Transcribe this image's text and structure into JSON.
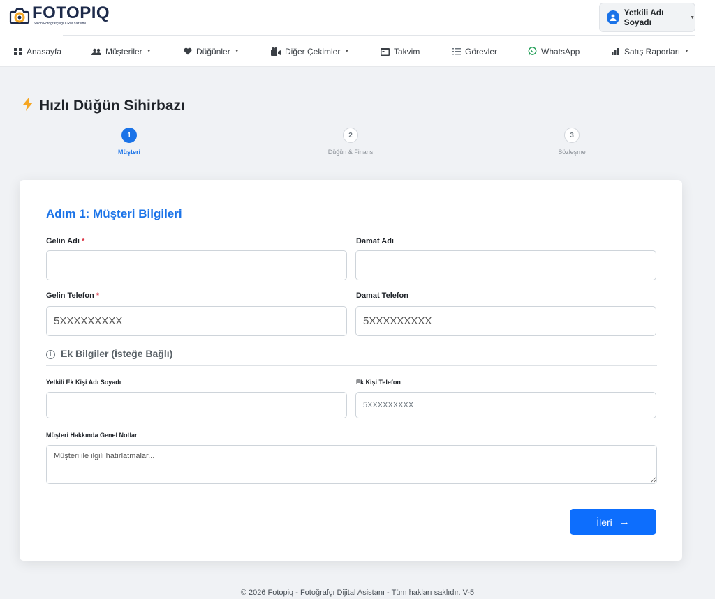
{
  "brand": {
    "name": "FOTOPIQ",
    "tagline": "Salon Fotoğrafçılığı CRM Yazılımı",
    "accent": "#1a73e8"
  },
  "user": {
    "name": "Yetkili Adı Soyadı"
  },
  "nav": {
    "items": [
      {
        "label": "Anasayfa",
        "icon": "grid-icon"
      },
      {
        "label": "Müşteriler",
        "icon": "users-icon"
      },
      {
        "label": "Düğünler",
        "icon": "heart-icon"
      },
      {
        "label": "Diğer Çekimler",
        "icon": "camera-icon"
      },
      {
        "label": "Takvim",
        "icon": "calendar-icon"
      },
      {
        "label": "Görevler",
        "icon": "list-icon"
      },
      {
        "label": "WhatsApp",
        "icon": "whatsapp-icon"
      },
      {
        "label": "Satış Raporları",
        "icon": "bar-chart-icon"
      }
    ]
  },
  "wizard": {
    "title": "Hızlı Düğün Sihirbazı",
    "steps": [
      {
        "number": "1",
        "label": "Müşteri",
        "state": "active"
      },
      {
        "number": "2",
        "label": "Düğün & Finans",
        "state": "idle"
      },
      {
        "number": "3",
        "label": "Sözleşme",
        "state": "idle"
      }
    ]
  },
  "form": {
    "title": "Adım 1: Müşteri Bilgileri",
    "required_mark": "*",
    "gelin_adi": {
      "label": "Gelin Adı",
      "value": "",
      "placeholder": ""
    },
    "damat_adi": {
      "label": "Damat Adı",
      "value": "",
      "placeholder": ""
    },
    "gelin_telefon": {
      "label": "Gelin Telefon",
      "value": "",
      "placeholder": "5XXXXXXXXX"
    },
    "damat_telefon": {
      "label": "Damat Telefon",
      "value": "",
      "placeholder": "5XXXXXXXXX"
    },
    "ek_bilgiler": {
      "label": "Ek Bilgiler (İsteğe Bağlı)",
      "icon": "plus-circle-icon"
    },
    "ek_kisi_adi": {
      "label": "Yetkili Ek Kişi Adı Soyadı",
      "value": "",
      "placeholder": ""
    },
    "ek_kisi_telefon": {
      "label": "Ek Kişi Telefon",
      "value": "",
      "placeholder": "5XXXXXXXXX"
    },
    "notlar": {
      "label": "Müşteri Hakkında Genel Notlar",
      "value": "",
      "placeholder": "Müşteri ile ilgili hatırlatmalar..."
    },
    "next_button": {
      "label": "İleri",
      "icon": "arrow-right-icon"
    }
  },
  "footer": {
    "text": "© 2026 Fotopiq - Fotoğrafçı Dijital Asistanı - Tüm hakları saklıdır. V-5"
  }
}
